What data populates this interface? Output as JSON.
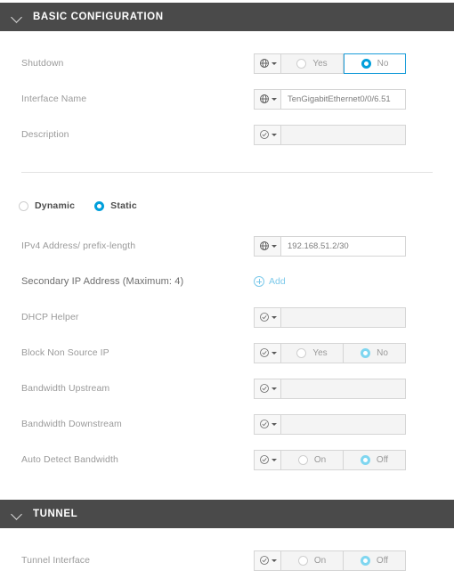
{
  "sections": [
    {
      "id": "basic-configuration",
      "title": "BASIC CONFIGURATION",
      "collapse_icon": "chevron-down-icon"
    },
    {
      "id": "tunnel",
      "title": "TUNNEL",
      "collapse_icon": "chevron-down-icon"
    }
  ],
  "basic": {
    "shutdown": {
      "label": "Shutdown",
      "scope_icon": "globe-icon",
      "yes_label": "Yes",
      "no_label": "No",
      "selected": "No"
    },
    "interface_name": {
      "label": "Interface Name",
      "scope_icon": "globe-icon",
      "value": "TenGigabitEthernet0/0/6.51"
    },
    "description": {
      "label": "Description",
      "scope_icon": "check-circle-icon",
      "value": "",
      "placeholder": ""
    }
  },
  "address_mode": {
    "dynamic_label": "Dynamic",
    "static_label": "Static",
    "selected": "Static"
  },
  "static": {
    "ipv4": {
      "label": "IPv4 Address/ prefix-length",
      "scope_icon": "globe-icon",
      "value": "192.168.51.2/30"
    },
    "secondary_ip": {
      "label": "Secondary IP Address (Maximum: 4)",
      "add_label": "Add",
      "add_icon": "plus-circle-icon"
    },
    "dhcp_helper": {
      "label": "DHCP Helper",
      "scope_icon": "check-circle-icon",
      "value": ""
    },
    "block_non_source_ip": {
      "label": "Block Non Source IP",
      "scope_icon": "check-circle-icon",
      "yes_label": "Yes",
      "no_label": "No",
      "selected": "No"
    },
    "bandwidth_upstream": {
      "label": "Bandwidth Upstream",
      "scope_icon": "check-circle-icon",
      "value": ""
    },
    "bandwidth_downstream": {
      "label": "Bandwidth Downstream",
      "scope_icon": "check-circle-icon",
      "value": ""
    },
    "auto_detect_bandwidth": {
      "label": "Auto Detect Bandwidth",
      "scope_icon": "check-circle-icon",
      "on_label": "On",
      "off_label": "Off",
      "selected": "Off"
    }
  },
  "tunnel": {
    "tunnel_interface": {
      "label": "Tunnel Interface",
      "scope_icon": "check-circle-icon",
      "on_label": "On",
      "off_label": "Off",
      "selected": "Off"
    }
  },
  "colors": {
    "header_bg": "#4a4a4a",
    "accent_blue": "#009fdb",
    "accent_blue_faded": "#7fd6f0",
    "link_blue": "#7cc9ea",
    "label_gray": "#9a9a9a"
  }
}
